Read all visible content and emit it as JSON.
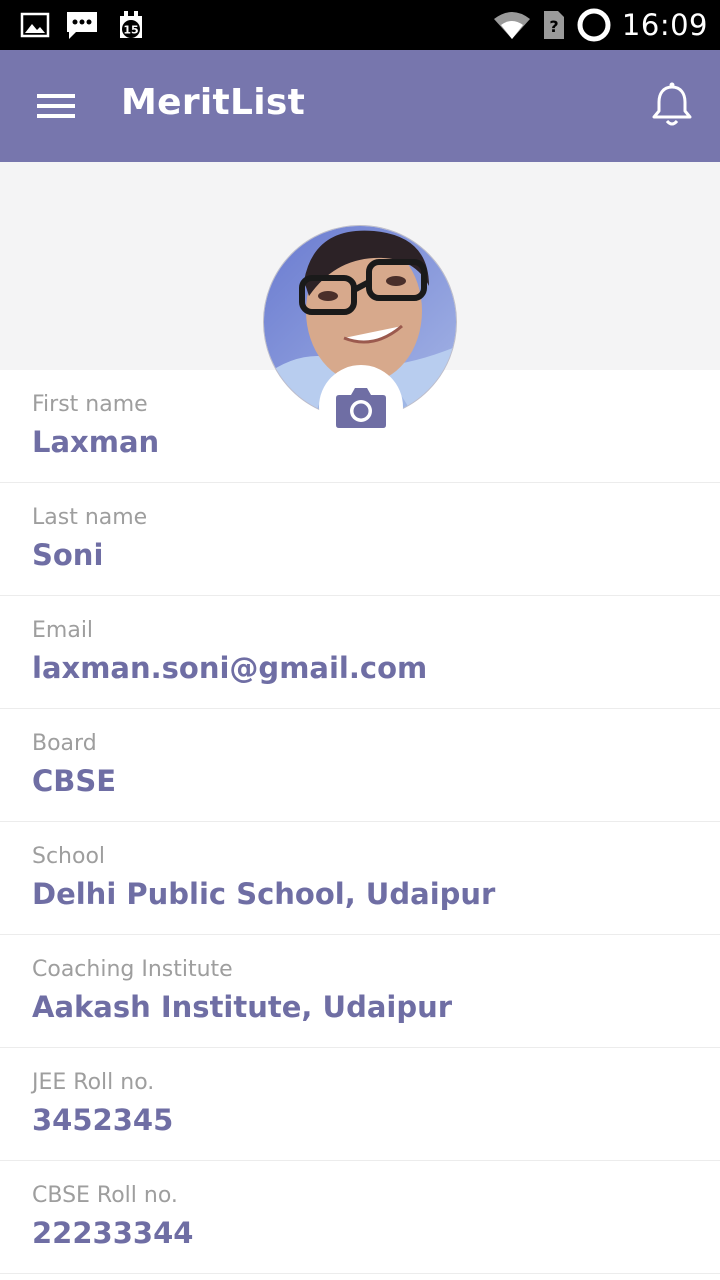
{
  "status_bar": {
    "time": "16:09",
    "notification_badge": "15",
    "icons": [
      "image-icon",
      "message-icon",
      "calendar-badge-icon",
      "wifi-icon",
      "no-sim-icon",
      "loading-ring-icon"
    ]
  },
  "app_bar": {
    "title": "MeritList",
    "background_color": "#7776ad",
    "icons": [
      "menu-icon",
      "bell-icon"
    ]
  },
  "profile": {
    "avatar_alt": "profile-photo",
    "camera_icon": "camera-icon"
  },
  "fields": [
    {
      "label": "First name",
      "value": "Laxman"
    },
    {
      "label": "Last name",
      "value": "Soni"
    },
    {
      "label": "Email",
      "value": "laxman.soni@gmail.com"
    },
    {
      "label": "Board",
      "value": "CBSE"
    },
    {
      "label": "School",
      "value": "Delhi Public School, Udaipur"
    },
    {
      "label": "Coaching Institute",
      "value": "Aakash Institute, Udaipur"
    },
    {
      "label": "JEE Roll no.",
      "value": "3452345"
    },
    {
      "label": "CBSE Roll no.",
      "value": "22233344"
    }
  ],
  "colors": {
    "accent": "#6f6ea4",
    "label": "#9e9e9e",
    "header_bg": "#f4f4f5"
  }
}
